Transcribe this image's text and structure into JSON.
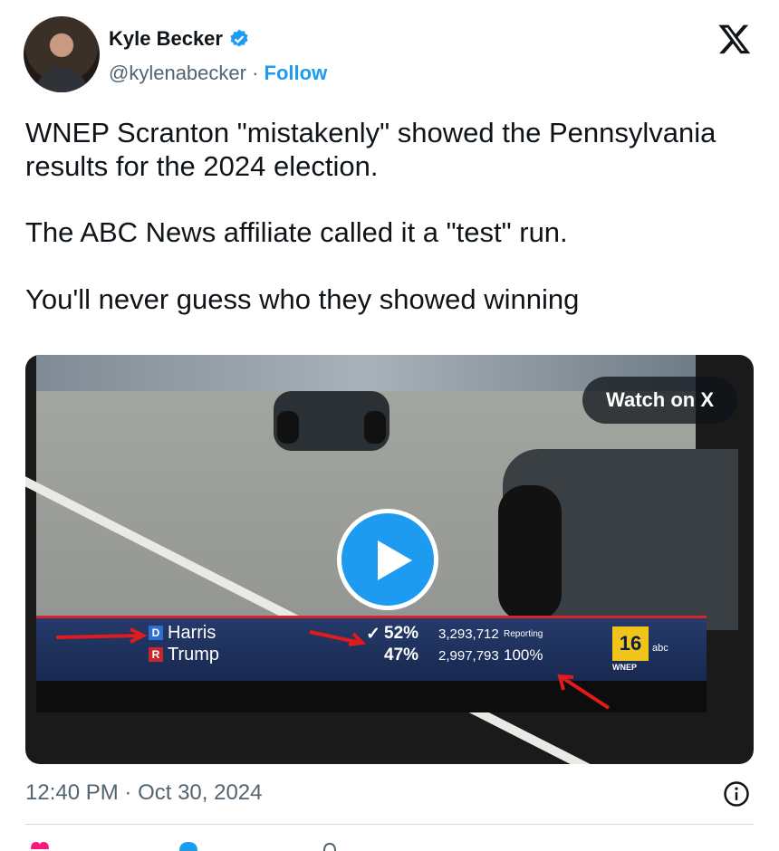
{
  "author": {
    "name": "Kyle Becker",
    "handle": "@kylenabecker",
    "separator": " · ",
    "follow_label": "Follow",
    "verified": true
  },
  "tweet": {
    "paragraphs": [
      "WNEP Scranton \"mistakenly\" showed the Pennsylvania results for the 2024 election.",
      "The ABC News affiliate called it a \"test\" run.",
      "You'll never guess who they showed winning"
    ]
  },
  "video": {
    "watch_label": "Watch on X",
    "lower_third": {
      "candidates": [
        {
          "party": "D",
          "name": "Harris",
          "pct": "52%",
          "check": "✓",
          "votes": "3,293,712"
        },
        {
          "party": "R",
          "name": "Trump",
          "pct": "47%",
          "check": "",
          "votes": "2,997,793"
        }
      ],
      "reporting_label": "Reporting",
      "reporting_value": "100%",
      "station_number": "16",
      "station_network": "abc",
      "station_call": "WNEP"
    }
  },
  "meta": {
    "time": "12:40 PM",
    "date": "Oct 30, 2024",
    "separator": " · "
  },
  "colors": {
    "accent": "#1d9bf0",
    "secondary_text": "#536471",
    "arrow": "#e01b1b"
  },
  "icons": [
    "verified-badge-icon",
    "x-logo-icon",
    "play-icon",
    "info-icon",
    "heart-icon",
    "reply-icon",
    "share-icon"
  ]
}
